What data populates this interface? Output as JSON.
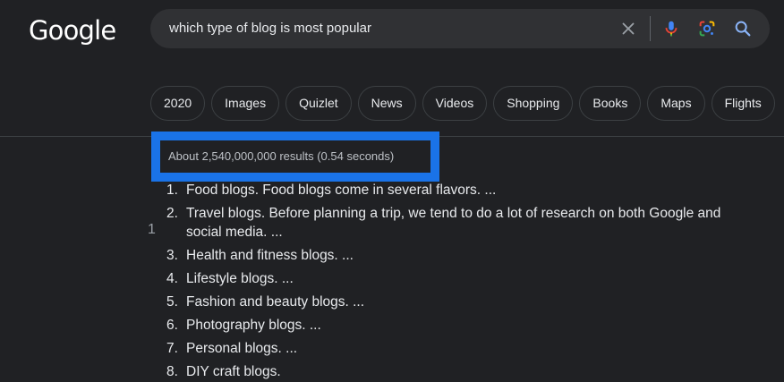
{
  "logo": {
    "text": "Google"
  },
  "search": {
    "query": "which type of blog is most popular"
  },
  "icons": {
    "clear": "close-icon",
    "mic": "microphone-icon",
    "lens": "google-lens-icon",
    "search": "search-icon"
  },
  "chips": [
    "2020",
    "Images",
    "Quizlet",
    "News",
    "Videos",
    "Shopping",
    "Books",
    "Maps",
    "Flights"
  ],
  "results": {
    "stats": "About 2,540,000,000 results (0.54 seconds)"
  },
  "side_marker": "1",
  "list": [
    {
      "num": "1.",
      "text": "Food blogs. Food blogs come in several flavors. ..."
    },
    {
      "num": "2.",
      "text": "Travel blogs. Before planning a trip, we tend to do a lot of research on both Google and social media. ..."
    },
    {
      "num": "3.",
      "text": "Health and fitness blogs. ..."
    },
    {
      "num": "4.",
      "text": "Lifestyle blogs. ..."
    },
    {
      "num": "5.",
      "text": "Fashion and beauty blogs. ..."
    },
    {
      "num": "6.",
      "text": "Photography blogs. ..."
    },
    {
      "num": "7.",
      "text": "Personal blogs. ..."
    },
    {
      "num": "8.",
      "text": "DIY craft blogs."
    }
  ],
  "colors": {
    "background": "#202124",
    "searchbar": "#303134",
    "highlight": "#1a73e8",
    "text": "#e8eaed"
  }
}
